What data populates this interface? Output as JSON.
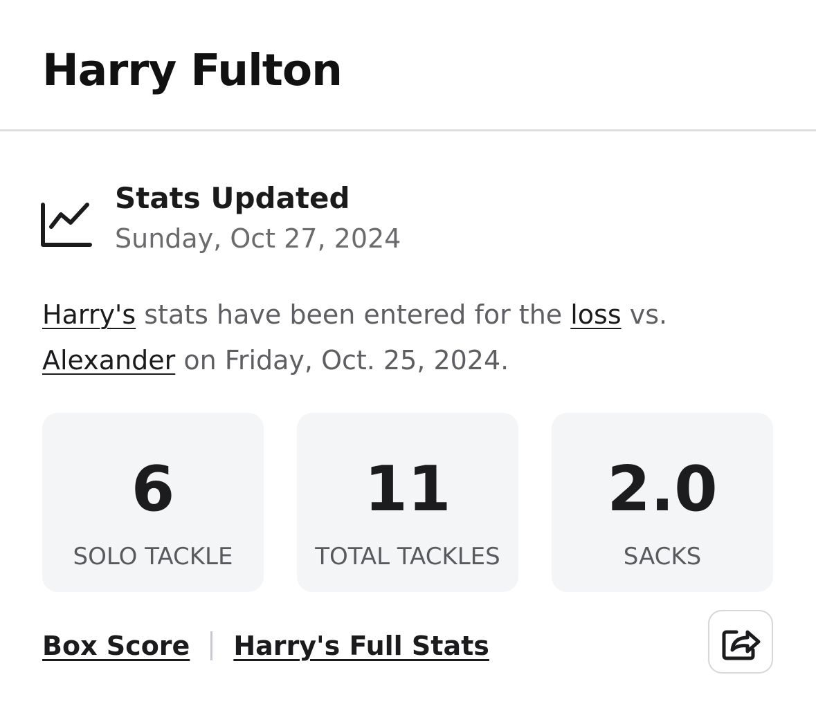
{
  "player": {
    "name": "Harry Fulton"
  },
  "update": {
    "icon": "line-chart-icon",
    "title": "Stats Updated",
    "date": "Sunday, Oct 27, 2024"
  },
  "summary": {
    "player_link": "Harry's",
    "text_1": " stats have been entered for the ",
    "result_link": "loss",
    "text_2": " vs. ",
    "opponent_link": "Alexander",
    "text_3": " on Friday, Oct. 25, 2024."
  },
  "stats": [
    {
      "value": "6",
      "label": "SOLO TACKLE"
    },
    {
      "value": "11",
      "label": "TOTAL TACKLES"
    },
    {
      "value": "2.0",
      "label": "SACKS"
    }
  ],
  "footer": {
    "box_score_label": "Box Score",
    "full_stats_label": "Harry's Full Stats",
    "share_icon": "share-icon"
  },
  "colors": {
    "text_primary": "#1b1b1d",
    "text_secondary": "#6b6b6e",
    "stat_box_bg": "#f4f5f7",
    "divider": "#dedfe2"
  }
}
